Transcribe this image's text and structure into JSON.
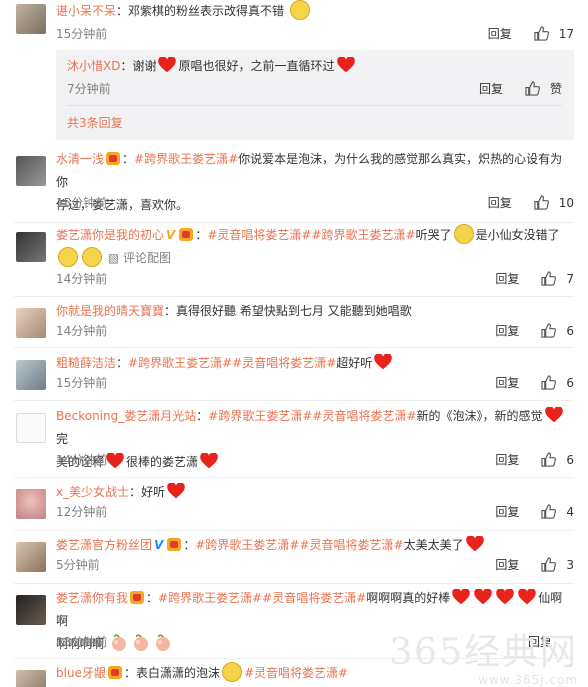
{
  "labels": {
    "reply": "回复",
    "like_word": "赞",
    "image_link": "评论配图"
  },
  "comments": [
    {
      "user": "谌小呆不呆",
      "text": "：邓紫棋的粉丝表示改得真不错",
      "time": "15分钟前",
      "likes": "17"
    },
    {
      "user": "沐小惜XD",
      "text": "：谢谢",
      "text2": "原唱也很好，之前一直循环过",
      "time": "7分钟前"
    },
    {
      "more": "共3条回复"
    },
    {
      "user": "水清一浅",
      "tag1": "#跨界歌王娄艺潇#",
      "text": "你说爱本是泡沫，为什么我的感觉那么真实，炽热的心设有为你",
      "text_l2": "停过，娄艺潇，喜欢你。",
      "time": "15分钟前",
      "likes": "10"
    },
    {
      "user": "娄艺潇你是我的初心",
      "tag1": "#灵音唱将娄艺潇#",
      "tag2": "#跨界歌王娄艺潇#",
      "text": "听哭了",
      "text2": "是小仙女没错了",
      "time": "14分钟前",
      "likes": "7"
    },
    {
      "user": "你就是我的晴天寶寶",
      "text": "：真得很好聽 希望快點到七月 又能聽到她唱歌",
      "time": "14分钟前",
      "likes": "6"
    },
    {
      "user": "粗糙薛洁洁",
      "tag1": "#跨界歌王娄艺潇#",
      "tag2": "#灵音唱将娄艺潇#",
      "text": "超好听",
      "time": "15分钟前",
      "likes": "6"
    },
    {
      "user": "Beckoning_娄艺潇月光站",
      "tag1": "#跨界歌王娄艺潇#",
      "tag2": "#灵音唱将娄艺潇#",
      "text": "新的《泡沫》，新的感觉",
      "text_tail": "完",
      "text_l2": "美的诠释",
      "text2": "很棒的娄艺潇",
      "time": "14分钟前",
      "likes": "6"
    },
    {
      "user": "x_美少女战士",
      "text": "：好听",
      "time": "12分钟前",
      "likes": "4"
    },
    {
      "user": "娄艺潇官方粉丝团",
      "tag1": "#跨界歌王娄艺潇#",
      "tag2": "#灵音唱将娄艺潇#",
      "text": "太美太美了",
      "time": "5分钟前",
      "likes": "3"
    },
    {
      "user": "娄艺潇你有我",
      "tag1": "#跨界歌王娄艺潇#",
      "tag2": "#灵音唱将娄艺潇#",
      "text": "啊啊啊真的好棒",
      "text2": "仙啊啊",
      "text_l2": "啊啊啊啊",
      "time": "13分钟前"
    },
    {
      "user": "blue牙龈",
      "text": "：表白潇潇的泡沫",
      "tag1": "#灵音唱将娄艺潇#"
    }
  ],
  "watermark": {
    "main": "365经典网",
    "sub": "www.365j.com"
  },
  "colors": {
    "accent": "#eb7350",
    "time": "#808080",
    "heart": "#e8231c",
    "badge": "#f5a623"
  }
}
